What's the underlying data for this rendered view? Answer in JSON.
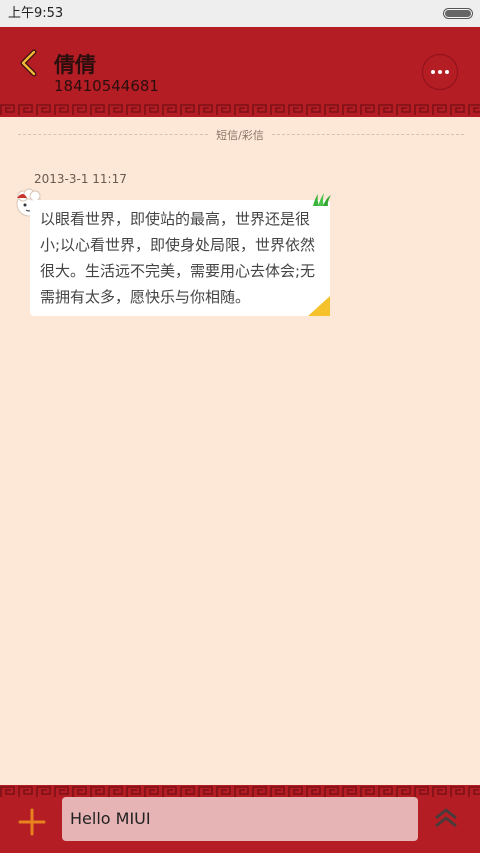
{
  "status_bar": {
    "time": "上午9:53"
  },
  "header": {
    "contact_name": "倩倩",
    "contact_number": "18410544681",
    "back_icon": "chevron-left-icon",
    "more_icon": "more-dots-icon"
  },
  "thread": {
    "type_label": "短信/彩信",
    "messages": [
      {
        "timestamp": "2013-3-1 11:17",
        "text": "以眼看世界，即使站的最高，世界还是很小;以心看世界，即使身处局限，世界依然很大。生活远不完美，需要用心去体会;无需拥有太多，愿快乐与你相随。",
        "avatar_icon": "sheep-avatar-icon"
      }
    ]
  },
  "composer": {
    "input_value": "Hello MIUI",
    "add_icon": "plus-icon",
    "expand_icon": "chevron-up-icon"
  },
  "colors": {
    "theme_red": "#b51d25",
    "background": "#fde8d7",
    "input_bg": "#e7b4b5",
    "accent_orange": "#e8821e"
  }
}
